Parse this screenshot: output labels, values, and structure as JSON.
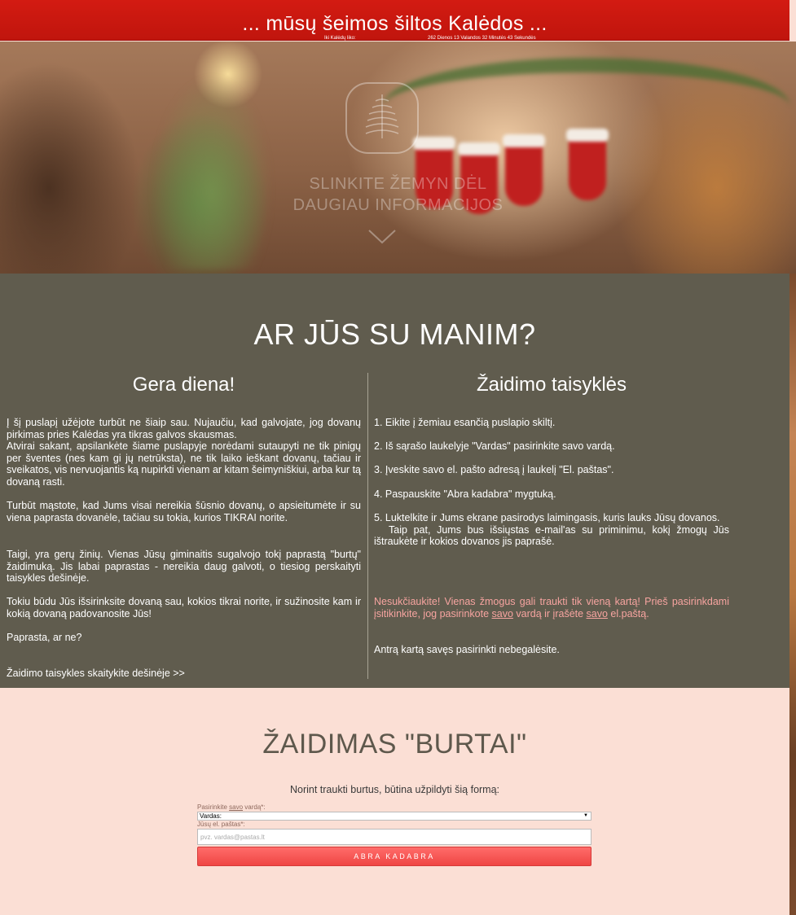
{
  "header": {
    "title": "... mūsų šeimos šiltos Kalėdos ...",
    "countdown_label": "Iki Kalėdų liko:",
    "countdown_value": "262 Dienos 13 Valandos 32 Minutės 43 Sekundės"
  },
  "hero": {
    "scroll_text_line1": "SLINKITE ŽEMYN DĖL",
    "scroll_text_line2": "DAUGIAU INFORMACIJOS",
    "logo_icon": "tree-icon",
    "chevron_icon": "chevron-down-icon"
  },
  "about": {
    "title": "AR JŪS SU MANIM?",
    "left": {
      "heading": "Gera diena!",
      "p1": "Į šį puslapį užėjote turbūt ne šiaip sau. Nujaučiu, kad galvojate, jog dovanų pirkimas pries Kalėdas yra tikras galvos skausmas.\nAtvirai sakant, apsilankėte šiame puslapyje norėdami sutaupyti ne tik pinigų per šventes (nes kam gi jų netrūksta), ne tik laiko ieškant dovanų, tačiau ir sveikatos, vis nervuojantis ką nupirkti vienam ar kitam šeimyniškiui, arba kur tą dovaną rasti.",
      "p2": "Turbūt mąstote, kad Jums visai nereikia šūsnio dovanų, o apsieitumėte ir su viena paprasta dovanėle, tačiau su tokia, kurios TIKRAI norite.",
      "p3": "Taigi, yra gerų žinių. Vienas Jūsų giminaitis sugalvojo tokį paprastą \"burtų\" žaidimuką. Jis labai paprastas - nereikia daug galvoti, o tiesiog perskaityti taisykles dešinėje.",
      "p4": "Tokiu būdu Jūs išsirinksite dovaną sau, kokios tikrai norite, ir sužinosite kam ir kokią dovaną padovanosite Jūs!",
      "p5": "Paprasta, ar ne?",
      "p6": "Žaidimo taisykles skaitykite dešinėje >>"
    },
    "right": {
      "heading": "Žaidimo taisyklės",
      "rule1": "1. Eikite į žemiau esančią puslapio skiltį.",
      "rule2": "2. Iš sąrašo laukelyje \"Vardas\" pasirinkite savo vardą.",
      "rule3": "3. Įveskite savo el. pašto adresą į laukelį \"El. paštas\".",
      "rule4": "4. Paspauskite \"Abra kadabra\" mygtuką.",
      "rule5": "5. Luktelkite ir Jums ekrane pasirodys laimingasis, kuris lauks Jūsų dovanos.",
      "rule5b": "Taip pat, Jums bus išsiųstas e-mail'as su priminimu, kokį žmogų Jūs ištraukėte ir kokios dovanos jis paprašė.",
      "warning_a": "Nesukčiaukite! Vienas žmogus gali traukti tik vieną kartą! Prieš pasirinkdami įsitikinkite, jog pasirinkote ",
      "warning_u1": "savo",
      "warning_b": " vardą ir įrašėte ",
      "warning_u2": "savo",
      "warning_c": " el.paštą.",
      "second_try": "Antrą kartą savęs pasirinkti nebegalėsite."
    }
  },
  "game": {
    "title": "ŽAIDIMAS \"BURTAI\"",
    "intro": "Norint traukti burtus, būtina užpildyti šią formą:",
    "name_label_a": "Pasirinkite ",
    "name_label_u": "savo",
    "name_label_b": " vardą*:",
    "name_select_value": "Vardas:",
    "email_label": "Jūsų el. paštas*:",
    "email_placeholder": "pvz. vardas@pastas.lt",
    "submit_label": "ABRA KADABRA"
  },
  "colors": {
    "topbar": "#d31b12",
    "about_bg": "#605c4e",
    "game_bg": "#fbdfd5",
    "button": "#ef4644",
    "warning_text": "#f7a4a0"
  }
}
